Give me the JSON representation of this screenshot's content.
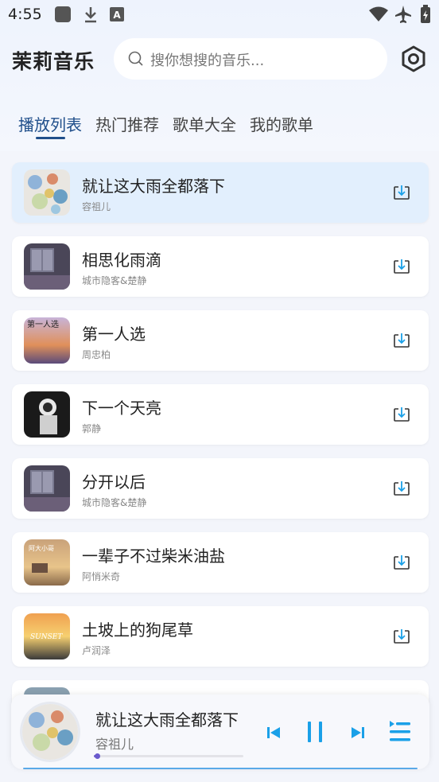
{
  "status_bar": {
    "time": "4:55"
  },
  "header": {
    "app_title": "茉莉音乐",
    "search_placeholder": "搜你想搜的音乐..."
  },
  "tabs": [
    {
      "label": "播放列表",
      "active": true
    },
    {
      "label": "热门推荐",
      "active": false
    },
    {
      "label": "歌单大全",
      "active": false
    },
    {
      "label": "我的歌单",
      "active": false
    }
  ],
  "songs": [
    {
      "title": "就让这大雨全都落下",
      "artist": "容祖儿",
      "active": true
    },
    {
      "title": "相思化雨滴",
      "artist": "城市隐客&楚静"
    },
    {
      "title": "第一人选",
      "artist": "周忠柏",
      "cover_text": "第一人选"
    },
    {
      "title": "下一个天亮",
      "artist": "郭静"
    },
    {
      "title": "分开以后",
      "artist": "城市隐客&楚静"
    },
    {
      "title": "一辈子不过柴米油盐",
      "artist": "阿悄米奇",
      "cover_text": "阿大小哥"
    },
    {
      "title": "土坡上的狗尾草",
      "artist": "卢润泽",
      "cover_text": "SUNSET"
    }
  ],
  "player": {
    "title": "就让这大雨全都落下",
    "artist": "容祖儿",
    "progress": 0.02
  },
  "colors": {
    "accent": "#1f4e8a",
    "control_blue": "#1aa0e8",
    "active_row": "#e2effd",
    "progress": "#6a5acd"
  }
}
